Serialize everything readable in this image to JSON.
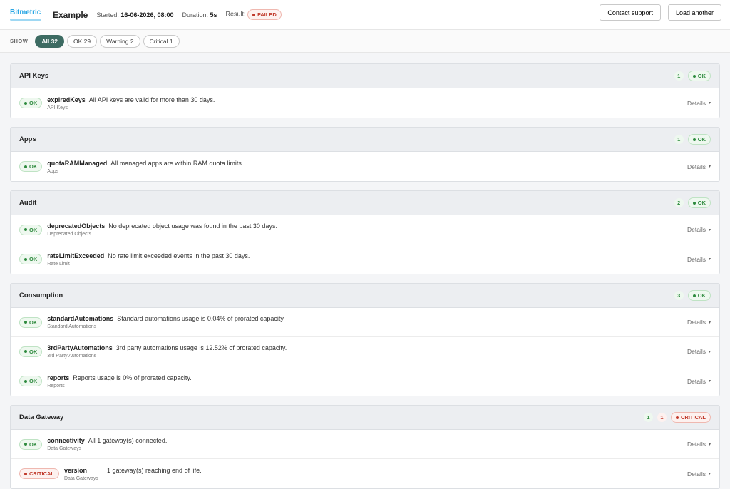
{
  "header": {
    "brand": "Bitmetric",
    "title": "Example",
    "started_label": "Started:",
    "started_value": "16-06-2026, 08:00",
    "duration_label": "Duration:",
    "duration_value": "5s",
    "result_label": "Result:",
    "result_value": "FAILED",
    "contact_label": "Contact support",
    "load_label": "Load another"
  },
  "filters": {
    "show_label": "SHOW",
    "items": [
      {
        "label": "All 32",
        "active": true
      },
      {
        "label": "OK 29",
        "active": false
      },
      {
        "label": "Warning 2",
        "active": false
      },
      {
        "label": "Critical 1",
        "active": false
      }
    ]
  },
  "details_label": "Details",
  "sections": [
    {
      "title": "API Keys",
      "ok_count": "1",
      "status": "OK",
      "rows": [
        {
          "status": "OK",
          "name": "expiredKeys",
          "message": "All API keys are valid for more than 30 days.",
          "sub": "API Keys"
        }
      ]
    },
    {
      "title": "Apps",
      "ok_count": "1",
      "status": "OK",
      "rows": [
        {
          "status": "OK",
          "name": "quotaRAMManaged",
          "message": "All managed apps are within RAM quota limits.",
          "sub": "Apps"
        }
      ]
    },
    {
      "title": "Audit",
      "ok_count": "2",
      "status": "OK",
      "rows": [
        {
          "status": "OK",
          "name": "deprecatedObjects",
          "message": "No deprecated object usage was found in the past 30 days.",
          "sub": "Deprecated Objects"
        },
        {
          "status": "OK",
          "name": "rateLimitExceeded",
          "message": "No rate limit exceeded events in the past 30 days.",
          "sub": "Rate Limit"
        }
      ]
    },
    {
      "title": "Consumption",
      "ok_count": "3",
      "status": "OK",
      "rows": [
        {
          "status": "OK",
          "name": "standardAutomations",
          "message": "Standard automations usage is 0.04% of prorated capacity.",
          "sub": "Standard Automations"
        },
        {
          "status": "OK",
          "name": "3rdPartyAutomations",
          "message": "3rd party automations usage is 12.52% of prorated capacity.",
          "sub": "3rd Party Automations"
        },
        {
          "status": "OK",
          "name": "reports",
          "message": "Reports usage is 0% of prorated capacity.",
          "sub": "Reports"
        }
      ]
    },
    {
      "title": "Data Gateway",
      "ok_count": "1",
      "crit_count": "1",
      "status": "CRITICAL",
      "rows": [
        {
          "status": "OK",
          "name": "connectivity",
          "message": "All 1 gateway(s) connected.",
          "sub": "Data Gateways"
        },
        {
          "status": "CRITICAL",
          "name": "version",
          "message": "1 gateway(s) reaching end of life.",
          "sub": "Data Gateways"
        }
      ]
    }
  ]
}
